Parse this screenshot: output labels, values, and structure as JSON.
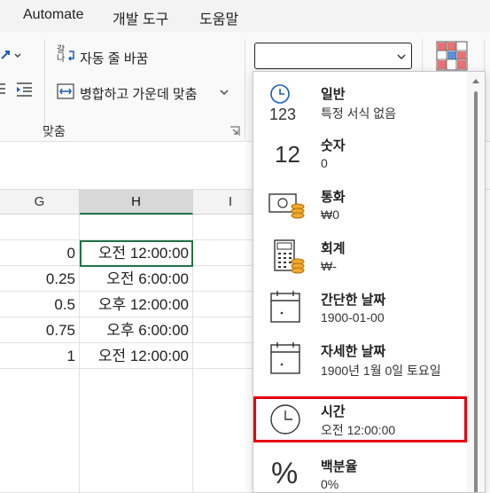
{
  "menu": {
    "automate": "Automate",
    "developer": "개발 도구",
    "help": "도움말"
  },
  "ribbon": {
    "wrap_text": "자동 줄 바꿈",
    "merge_center": "병합하고 가운데 맞춤",
    "group_label": "맞춤",
    "format_box_value": ""
  },
  "grid": {
    "col_g": "G",
    "col_h": "H",
    "col_i": "I",
    "rows": [
      {
        "g": "0",
        "h": "오전 12:00:00"
      },
      {
        "g": "0.25",
        "h": "오전 6:00:00"
      },
      {
        "g": "0.5",
        "h": "오후 12:00:00"
      },
      {
        "g": "0.75",
        "h": "오후 6:00:00"
      },
      {
        "g": "1",
        "h": "오전 12:00:00"
      }
    ]
  },
  "formats": [
    {
      "name": "일반",
      "example": "특정 서식 없음",
      "icon": "clock-123-icon"
    },
    {
      "name": "숫자",
      "example": "0",
      "icon": "number-12-icon",
      "icon_text": "12"
    },
    {
      "name": "통화",
      "example": "₩0",
      "icon": "currency-icon"
    },
    {
      "name": "회계",
      "example": "₩-",
      "icon": "accounting-icon"
    },
    {
      "name": "간단한 날짜",
      "example": "1900-01-00",
      "icon": "calendar-icon"
    },
    {
      "name": "자세한 날짜",
      "example": "1900년 1월 0일 토요일",
      "icon": "calendar-icon"
    },
    {
      "name": "시간",
      "example": "오전 12:00:00",
      "icon": "clock-icon",
      "highlighted": true
    },
    {
      "name": "백분율",
      "example": "0%",
      "icon": "percent-icon",
      "icon_text": "%"
    }
  ],
  "colors": {
    "accent_green": "#217346",
    "highlight_red": "#e3000f"
  }
}
